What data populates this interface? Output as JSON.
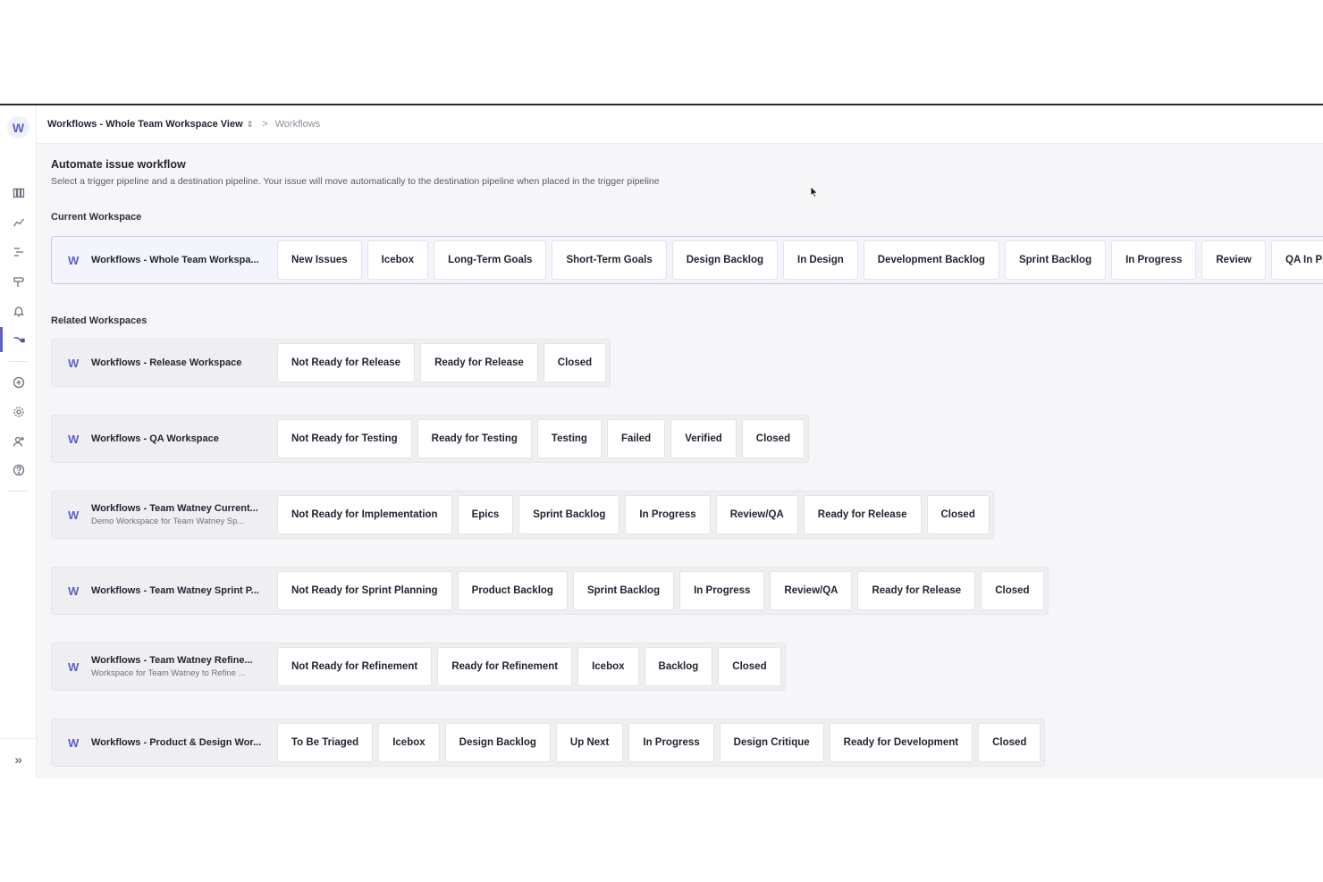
{
  "sidebar": {
    "logo_letter": "W",
    "icons": [
      "board-icon",
      "chart-icon",
      "roadmap-icon",
      "signpost-icon",
      "bell-icon",
      "workflow-icon",
      "add-circle-icon",
      "gear-icon",
      "add-user-icon",
      "help-icon"
    ],
    "active_icon": "workflow-icon",
    "expand_glyph": "»"
  },
  "breadcrumb": {
    "workspace": "Workflows - Whole Team Workspace View",
    "updown_glyph": "⇕",
    "chevron_glyph": ">",
    "current": "Workflows"
  },
  "page": {
    "title": "Automate issue workflow",
    "description": "Select a trigger pipeline and a destination pipeline. Your issue will move automatically to the destination pipeline when placed in the trigger pipeline",
    "current_label": "Current Workspace",
    "related_label": "Related Workspaces"
  },
  "current_workspace": {
    "letter": "W",
    "name": "Workflows - Whole Team Workspa...",
    "pipelines": [
      "New Issues",
      "Icebox",
      "Long-Term Goals",
      "Short-Term Goals",
      "Design Backlog",
      "In Design",
      "Development Backlog",
      "Sprint Backlog",
      "In Progress",
      "Review",
      "QA In Prog"
    ]
  },
  "related_workspaces": [
    {
      "letter": "W",
      "name": "Workflows - Release Workspace",
      "subtitle": "",
      "pipelines": [
        "Not Ready for Release",
        "Ready for Release",
        "Closed"
      ]
    },
    {
      "letter": "W",
      "name": "Workflows - QA Workspace",
      "subtitle": "",
      "pipelines": [
        "Not Ready for Testing",
        "Ready for Testing",
        "Testing",
        "Failed",
        "Verified",
        "Closed"
      ]
    },
    {
      "letter": "W",
      "name": "Workflows - Team Watney Current...",
      "subtitle": "Demo Workspace for Team Watney Sp...",
      "pipelines": [
        "Not Ready for Implementation",
        "Epics",
        "Sprint Backlog",
        "In Progress",
        "Review/QA",
        "Ready for Release",
        "Closed"
      ]
    },
    {
      "letter": "W",
      "name": "Workflows - Team Watney Sprint P...",
      "subtitle": "",
      "pipelines": [
        "Not Ready for Sprint Planning",
        "Product Backlog",
        "Sprint Backlog",
        "In Progress",
        "Review/QA",
        "Ready for Release",
        "Closed"
      ]
    },
    {
      "letter": "W",
      "name": "Workflows - Team Watney Refine...",
      "subtitle": "Workspace for Team Watney to Refine ...",
      "pipelines": [
        "Not Ready for Refinement",
        "Ready for Refinement",
        "Icebox",
        "Backlog",
        "Closed"
      ]
    },
    {
      "letter": "W",
      "name": "Workflows - Product & Design Wor...",
      "subtitle": "",
      "pipelines": [
        "To Be Triaged",
        "Icebox",
        "Design Backlog",
        "Up Next",
        "In Progress",
        "Design Critique",
        "Ready for Development",
        "Closed"
      ]
    }
  ],
  "colors": {
    "accent": "#5b5fc7",
    "background": "#f6f6f8",
    "card": "#ffffff"
  }
}
